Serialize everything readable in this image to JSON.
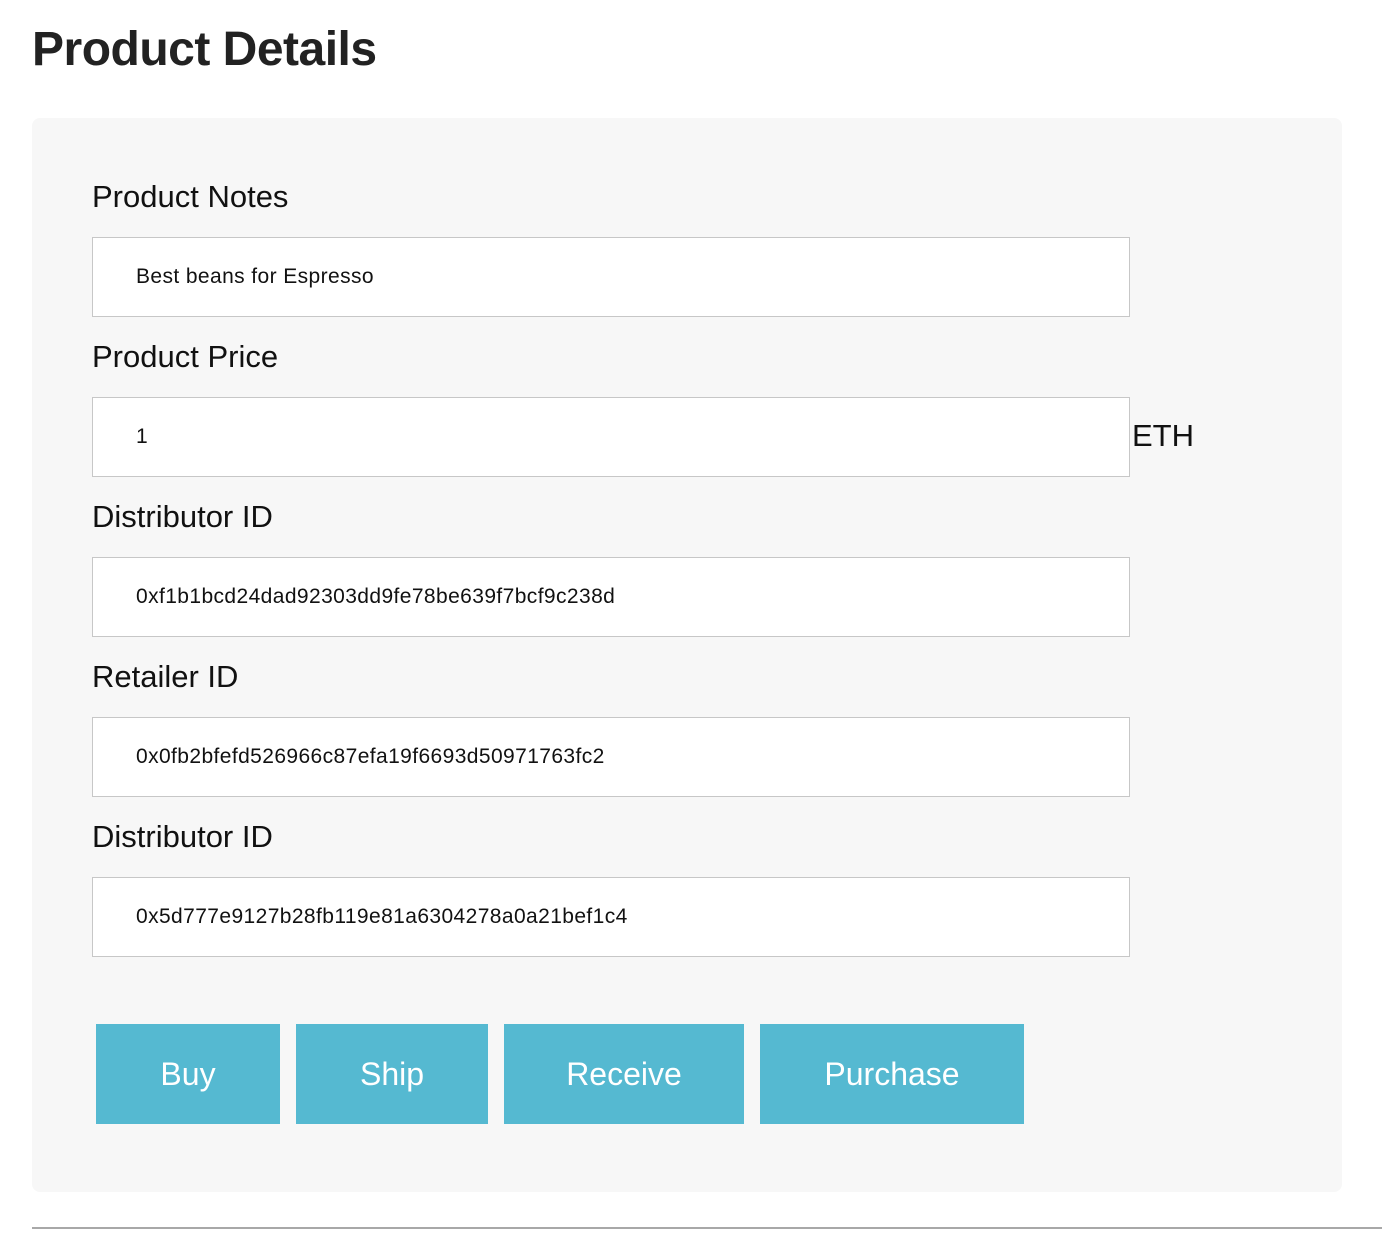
{
  "page": {
    "title": "Product Details"
  },
  "form": {
    "notes_label": "Product Notes",
    "notes_value": "Best beans for Espresso",
    "price_label": "Product Price",
    "price_value": "1",
    "price_unit": "ETH",
    "distributor_label": "Distributor ID",
    "distributor_value": "0xf1b1bcd24dad92303dd9fe78be639f7bcf9c238d",
    "retailer_label": "Retailer ID",
    "retailer_value": "0x0fb2bfefd526966c87efa19f6693d50971763fc2",
    "distributor2_label": "Distributor ID",
    "distributor2_value": "0x5d777e9127b28fb119e81a6304278a0a21bef1c4"
  },
  "actions": {
    "buy_label": "Buy",
    "ship_label": "Ship",
    "receive_label": "Receive",
    "purchase_label": "Purchase"
  },
  "colors": {
    "button_bg": "#55b9d1",
    "panel_bg": "#f7f7f7"
  }
}
